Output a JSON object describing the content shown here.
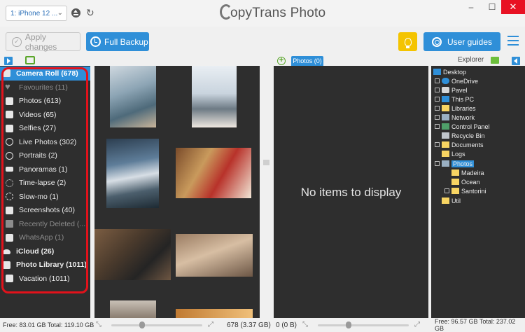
{
  "titlebar": {
    "device": "1: iPhone 12 ...",
    "app_title": "opyTrans Photo",
    "app_title_c": "C"
  },
  "toolbar": {
    "apply_label": "Apply changes",
    "backup_label": "Full Backup",
    "guides_label": "User guides"
  },
  "left_pane": {
    "items": [
      {
        "label": "Camera Roll (678)",
        "icon": "camera-icon"
      },
      {
        "label": "Favourites (11)",
        "icon": "heart-icon"
      },
      {
        "label": "Photos (613)",
        "icon": "camera-icon"
      },
      {
        "label": "Videos (65)",
        "icon": "video-icon"
      },
      {
        "label": "Selfies (27)",
        "icon": "selfie-icon"
      },
      {
        "label": "Live Photos (302)",
        "icon": "live-photo-icon"
      },
      {
        "label": "Portraits (2)",
        "icon": "portrait-icon"
      },
      {
        "label": "Panoramas (1)",
        "icon": "panorama-icon"
      },
      {
        "label": "Time-lapse (2)",
        "icon": "timelapse-icon"
      },
      {
        "label": "Slow-mo (1)",
        "icon": "slowmo-icon"
      },
      {
        "label": "Screenshots (40)",
        "icon": "screenshot-icon"
      },
      {
        "label": "Recently Deleted (...",
        "icon": "trash-icon"
      },
      {
        "label": "WhatsApp (1)",
        "icon": "album-icon"
      },
      {
        "label": "iCloud (26)",
        "icon": "cloud-icon"
      },
      {
        "label": "Photo Library (1011)",
        "icon": "camera-icon"
      },
      {
        "label": "Vacation (1011)",
        "icon": "album-icon"
      }
    ]
  },
  "middle_pane": {
    "tab_label": "Photos (0)",
    "empty_message": "No items to display"
  },
  "explorer": {
    "label": "Explorer",
    "tree": [
      {
        "label": "Desktop"
      },
      {
        "label": "OneDrive"
      },
      {
        "label": "Pavel"
      },
      {
        "label": "This PC"
      },
      {
        "label": "Libraries"
      },
      {
        "label": "Network"
      },
      {
        "label": "Control Panel"
      },
      {
        "label": "Recycle Bin"
      },
      {
        "label": "Documents"
      },
      {
        "label": "Logs"
      },
      {
        "label": "Photos"
      },
      {
        "label": "Madeira"
      },
      {
        "label": "Ocean"
      },
      {
        "label": "Santorini"
      },
      {
        "label": "Util"
      }
    ]
  },
  "statusbar": {
    "left_free": "Free: 83.01 GB Total: 119.10 GB",
    "grid_count": "678 (3.37 GB)",
    "drop_count": "0 (0 B)",
    "right_free": "Free: 96.57 GB Total: 237.02 GB"
  },
  "colors": {
    "accent": "#2f8fd8",
    "panel_bg": "#2e2e2e",
    "highlight_outline": "#e2121b",
    "bulb": "#f4c400",
    "green": "#5aa62a"
  }
}
